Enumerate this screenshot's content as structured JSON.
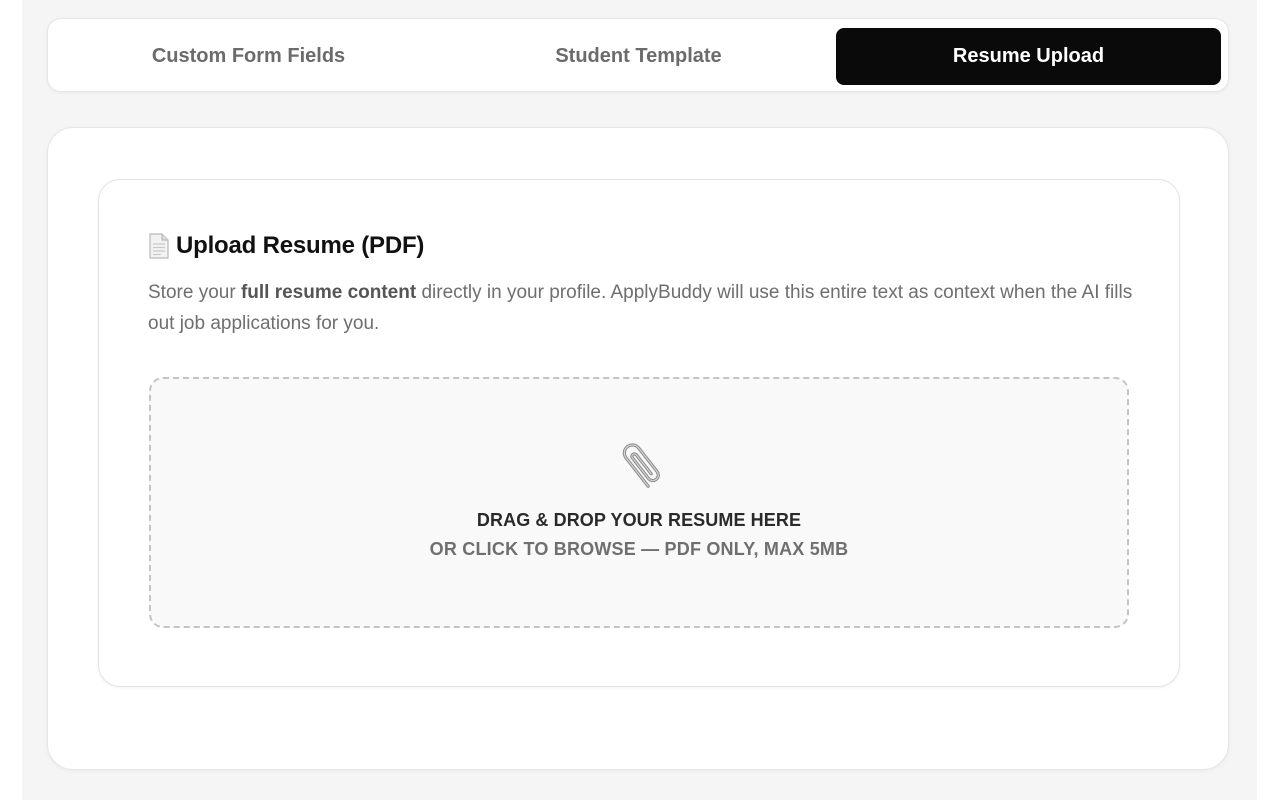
{
  "tabs": [
    {
      "label": "Custom Form Fields",
      "active": false
    },
    {
      "label": "Student Template",
      "active": false
    },
    {
      "label": "Resume Upload",
      "active": true
    }
  ],
  "upload_section": {
    "icon": "document-icon",
    "title": "Upload Resume (PDF)",
    "description_prefix": "Store your ",
    "description_bold": "full resume content",
    "description_suffix": " directly in your profile. ApplyBuddy will use this entire text as context when the AI fills out job applications for you."
  },
  "dropzone": {
    "icon": "paperclip-icon",
    "title": "DRAG & DROP YOUR RESUME HERE",
    "subtitle": "OR CLICK TO BROWSE — PDF ONLY, MAX 5MB"
  },
  "colors": {
    "active_tab_bg": "#0a0a0a",
    "page_bg": "#f5f5f5",
    "dropzone_bg": "#f9f9f9",
    "dropzone_border": "#c4c4c4"
  }
}
